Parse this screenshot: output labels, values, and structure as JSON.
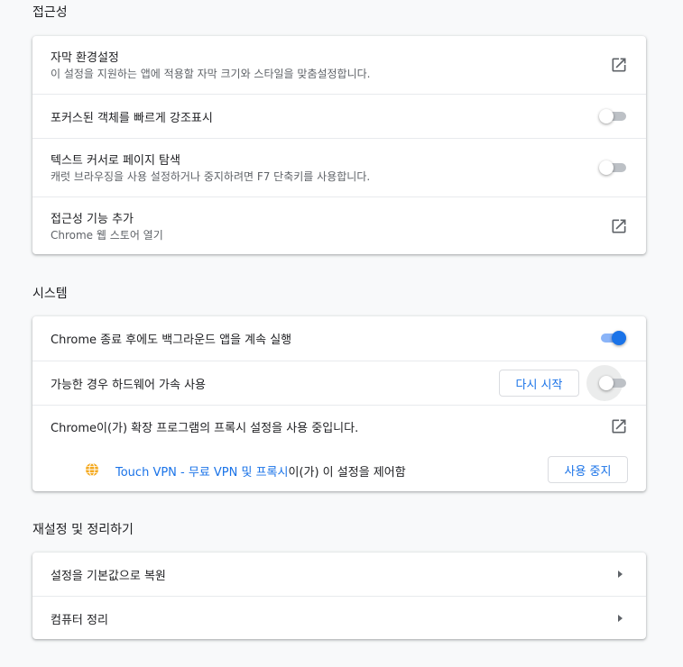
{
  "accessibility": {
    "title": "접근성",
    "captions": {
      "label": "자막 환경설정",
      "desc": "이 설정을 지원하는 앱에 적용할 자막 크기와 스타일을 맞춤설정합니다."
    },
    "focus_highlight": {
      "label": "포커스된 객체를 빠르게 강조표시",
      "enabled": false
    },
    "caret_browsing": {
      "label": "텍스트 커서로 페이지 탐색",
      "desc": "캐럿 브라우징을 사용 설정하거나 중지하려면 F7 단축키를 사용합니다.",
      "enabled": false
    },
    "add_features": {
      "label": "접근성 기능 추가",
      "desc": "Chrome 웹 스토어 열기"
    }
  },
  "system": {
    "title": "시스템",
    "background_apps": {
      "label": "Chrome 종료 후에도 백그라운드 앱을 계속 실행",
      "enabled": true
    },
    "hardware_accel": {
      "label": "가능한 경우 하드웨어 가속 사용",
      "enabled": false,
      "restart_label": "다시 시작"
    },
    "proxy": {
      "label": "Chrome이(가) 확장 프로그램의 프록시 설정을 사용 중입니다.",
      "extension_link": "Touch VPN - 무료 VPN 및 프록시",
      "extension_suffix": "이(가) 이 설정을 제어함",
      "disable_label": "사용 중지"
    }
  },
  "reset": {
    "title": "재설정 및 정리하기",
    "restore_label": "설정을 기본값으로 복원",
    "cleanup_label": "컴퓨터 정리"
  },
  "colors": {
    "accent": "#1a73e8",
    "toggle_off": "#bdc1c6",
    "vpn_icon": "#f4a91f"
  }
}
